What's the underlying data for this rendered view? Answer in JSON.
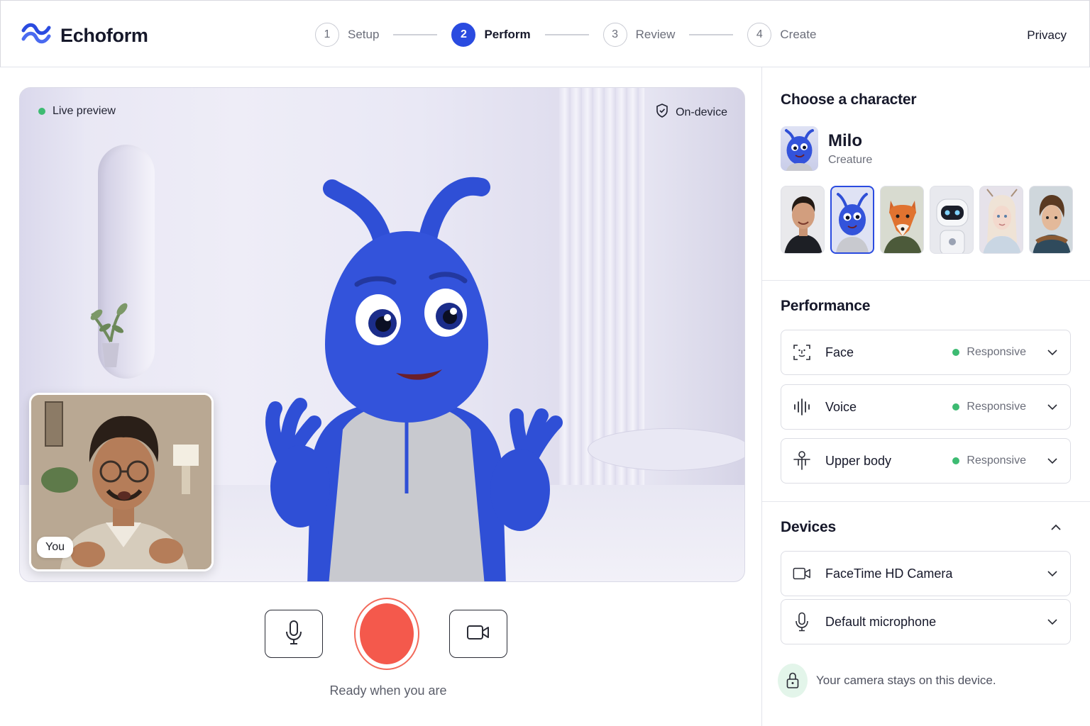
{
  "app": {
    "name": "Echoform"
  },
  "header": {
    "steps": [
      {
        "num": "1",
        "label": "Setup"
      },
      {
        "num": "2",
        "label": "Perform"
      },
      {
        "num": "3",
        "label": "Review"
      },
      {
        "num": "4",
        "label": "Create"
      }
    ],
    "active_step": 2,
    "privacy_label": "Privacy"
  },
  "stage": {
    "live_label": "Live preview",
    "ondevice_label": "On-device",
    "self_view_label": "You"
  },
  "controls": {
    "mic_icon": "microphone-icon",
    "record_icon": "record-button",
    "camera_icon": "video-camera-icon",
    "status_text": "Ready when you are"
  },
  "panel": {
    "character": {
      "title": "Choose a character",
      "selected_name": "Milo",
      "selected_type": "Creature",
      "options": [
        {
          "id": "human-man"
        },
        {
          "id": "milo",
          "selected": true
        },
        {
          "id": "fox"
        },
        {
          "id": "robot"
        },
        {
          "id": "elf"
        },
        {
          "id": "hero"
        }
      ]
    },
    "performance": {
      "title": "Performance",
      "items": [
        {
          "label": "Face",
          "status": "Responsive",
          "icon": "face-scan-icon"
        },
        {
          "label": "Voice",
          "status": "Responsive",
          "icon": "waveform-icon"
        },
        {
          "label": "Upper body",
          "status": "Responsive",
          "icon": "person-icon"
        }
      ]
    },
    "devices": {
      "title": "Devices",
      "camera": "FaceTime HD Camera",
      "microphone": "Default microphone"
    },
    "note": "Your camera stays on this device."
  },
  "colors": {
    "accent": "#2a4be0",
    "record": "#f4594c",
    "status_dot": "#3dbb72"
  }
}
